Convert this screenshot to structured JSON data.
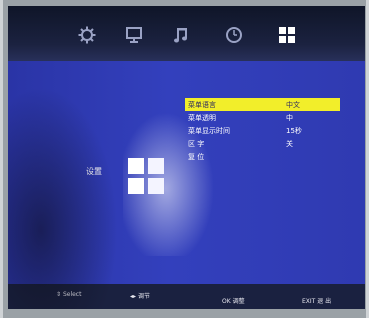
{
  "top_nav": {
    "icons": [
      "gear-icon",
      "monitor-icon",
      "music-note-icon",
      "clock-icon",
      "grid-icon"
    ],
    "active_index": 4
  },
  "section": {
    "label": "设置"
  },
  "menu": {
    "items": [
      {
        "label": "菜单语言",
        "value": "中文"
      },
      {
        "label": "菜单透明",
        "value": "中"
      },
      {
        "label": "菜单显示时间",
        "value": "15秒"
      },
      {
        "label": "区 字",
        "value": "关"
      },
      {
        "label": "复 位",
        "value": ""
      }
    ],
    "selected_index": 0,
    "highlight_color": "#f2ee2a"
  },
  "hints": {
    "select": "Select",
    "adjust": "调节",
    "ok": "OK 调整",
    "exit": "EXIT 退 出"
  }
}
